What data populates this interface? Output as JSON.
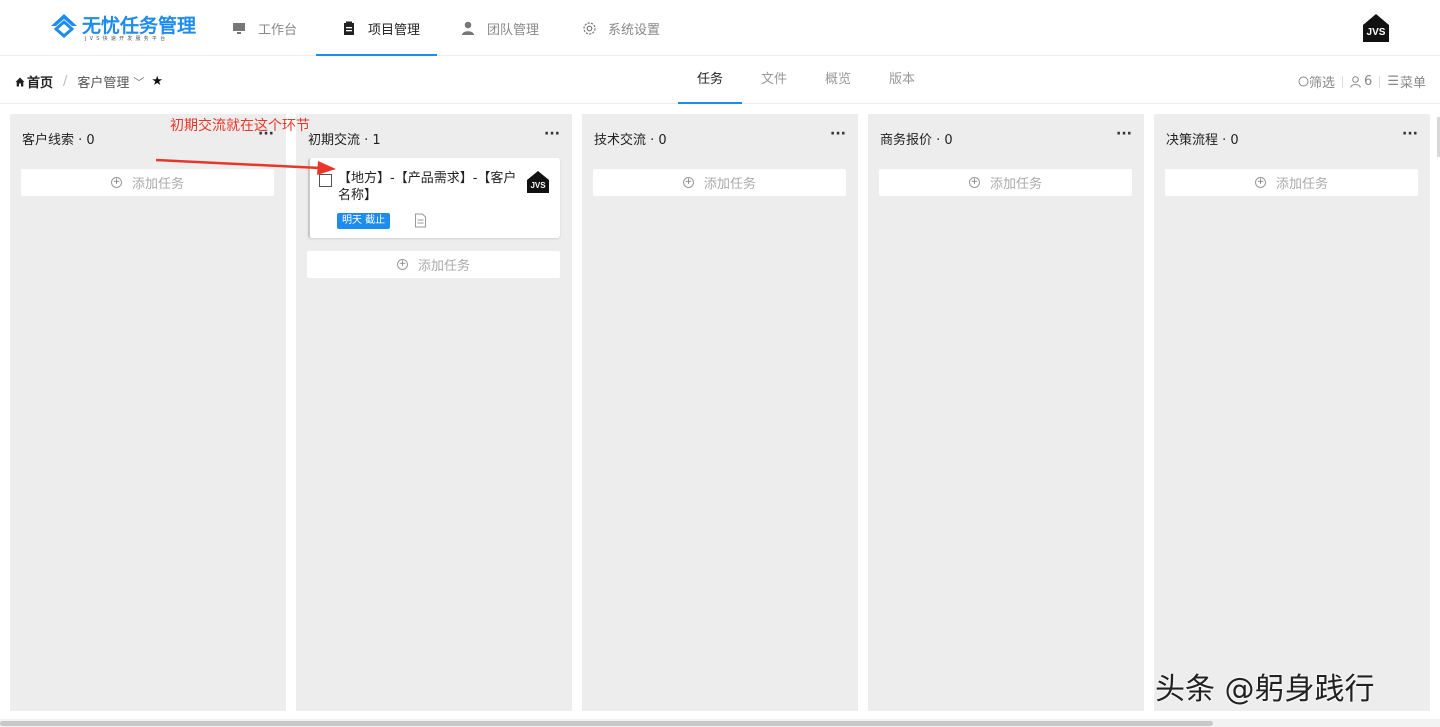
{
  "app": {
    "logo_name": "无忧任务管理",
    "logo_sub": "JVS快速开发服务平台",
    "avatar_text": "JVS"
  },
  "nav": [
    {
      "label": "工作台",
      "icon": "monitor-icon",
      "active": false
    },
    {
      "label": "项目管理",
      "icon": "clipboard-icon",
      "active": true
    },
    {
      "label": "团队管理",
      "icon": "user-icon",
      "active": false
    },
    {
      "label": "系统设置",
      "icon": "gear-icon",
      "active": false
    }
  ],
  "breadcrumb": {
    "home": "首页",
    "separator": "/",
    "current": "客户管理"
  },
  "tabs": [
    {
      "label": "任务",
      "active": true
    },
    {
      "label": "文件",
      "active": false
    },
    {
      "label": "概览",
      "active": false
    },
    {
      "label": "版本",
      "active": false
    }
  ],
  "tools": {
    "filter": "筛选",
    "members": "6",
    "menu": "菜单"
  },
  "columns": [
    {
      "title": "客户线索 · 0",
      "add_label": "添加任务"
    },
    {
      "title": "初期交流 · 1",
      "add_label": "添加任务",
      "card": {
        "title": "【地方】-【产品需求】-【客户名称】",
        "due": "明天 截止",
        "assignee": "JVS"
      }
    },
    {
      "title": "技术交流 · 0",
      "add_label": "添加任务"
    },
    {
      "title": "商务报价 · 0",
      "add_label": "添加任务"
    },
    {
      "title": "决策流程 · 0",
      "add_label": "添加任务"
    }
  ],
  "annotation": "初期交流就在这个环节",
  "watermark": "头条 @躬身践行",
  "colors": {
    "accent": "#1e8cef",
    "annotation": "#e8362a",
    "column_bg": "#ededed"
  }
}
